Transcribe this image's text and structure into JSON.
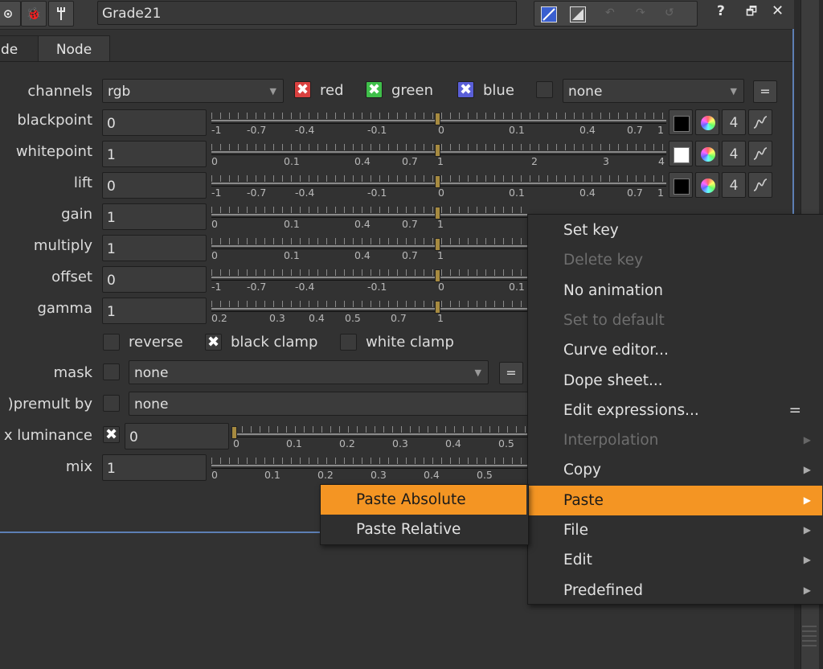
{
  "toolbar": {
    "node_name": "Grade21",
    "help_label": "?",
    "float_label": "🗗",
    "close_label": "✕"
  },
  "tabs": [
    {
      "label": "de"
    },
    {
      "label": "Node"
    }
  ],
  "params": {
    "channels": {
      "label": "channels",
      "value": "rgb",
      "red_label": "red",
      "green_label": "green",
      "blue_label": "blue",
      "extra_value": "none",
      "eq_label": "="
    },
    "rows": [
      {
        "label": "blackpoint",
        "value": "0",
        "swatch": "#000000",
        "count": "4",
        "ticks": [
          "-1",
          "-0.7",
          "-0.4",
          "-0.1",
          "0",
          "0.1",
          "0.4",
          "0.7",
          "1"
        ]
      },
      {
        "label": "whitepoint",
        "value": "1",
        "swatch": "#ffffff",
        "count": "4",
        "ticks": [
          "0",
          "0.1",
          "0.4",
          "0.7",
          "1",
          "2",
          "3",
          "4"
        ]
      },
      {
        "label": "lift",
        "value": "0",
        "swatch": "#000000",
        "count": "4",
        "ticks": [
          "-1",
          "-0.7",
          "-0.4",
          "-0.1",
          "0",
          "0.1",
          "0.4",
          "0.7",
          "1"
        ]
      },
      {
        "label": "gain",
        "value": "1",
        "ticks": [
          "0",
          "0.1",
          "0.4",
          "0.7",
          "1"
        ]
      },
      {
        "label": "multiply",
        "value": "1",
        "ticks": [
          "0",
          "0.1",
          "0.4",
          "0.7",
          "1"
        ]
      },
      {
        "label": "offset",
        "value": "0",
        "ticks": [
          "-1",
          "-0.7",
          "-0.4",
          "-0.1",
          "0",
          "0.1"
        ]
      },
      {
        "label": "gamma",
        "value": "1",
        "ticks": [
          "0.2",
          "0.3",
          "0.4",
          "0.5",
          "0.7",
          "1"
        ]
      }
    ],
    "reverse_label": "reverse",
    "black_clamp_label": "black clamp",
    "white_clamp_label": "white clamp",
    "mask": {
      "label": "mask",
      "value": "none",
      "eq_label": "="
    },
    "premult": {
      "label": ")premult by",
      "value": "none"
    },
    "luminance": {
      "label": "x luminance",
      "value": "0",
      "ticks": [
        "0",
        "0.1",
        "0.2",
        "0.3",
        "0.4",
        "0.5"
      ]
    },
    "mix": {
      "label": "mix",
      "value": "1",
      "ticks": [
        "0",
        "0.1",
        "0.2",
        "0.3",
        "0.4",
        "0.5"
      ]
    }
  },
  "context_menu": {
    "items": [
      {
        "label": "Set key",
        "disabled": false
      },
      {
        "label": "Delete key",
        "disabled": true
      },
      {
        "label": "No animation",
        "disabled": false
      },
      {
        "label": "Set to default",
        "disabled": true
      },
      {
        "label": "Curve editor...",
        "disabled": false
      },
      {
        "label": "Dope sheet...",
        "disabled": false
      },
      {
        "label": "Edit expressions...",
        "disabled": false,
        "shortcut": "="
      },
      {
        "label": "Interpolation",
        "disabled": true,
        "submenu": true
      },
      {
        "label": "Copy",
        "disabled": false,
        "submenu": true
      },
      {
        "label": "Paste",
        "disabled": false,
        "submenu": true,
        "highlighted": true
      },
      {
        "label": "File",
        "disabled": false,
        "submenu": true
      },
      {
        "label": "Edit",
        "disabled": false,
        "submenu": true
      },
      {
        "label": "Predefined",
        "disabled": false,
        "submenu": true
      }
    ]
  },
  "paste_submenu": {
    "items": [
      {
        "label": "Paste Absolute",
        "highlighted": true
      },
      {
        "label": "Paste Relative",
        "highlighted": false
      }
    ]
  },
  "colors": {
    "accent": "#f49523",
    "red_check": "#d9403f",
    "green_check": "#3fbf4a",
    "blue_check": "#5a5fd8",
    "knob": "#a68a40",
    "panel_outline": "#5d7fb4"
  }
}
